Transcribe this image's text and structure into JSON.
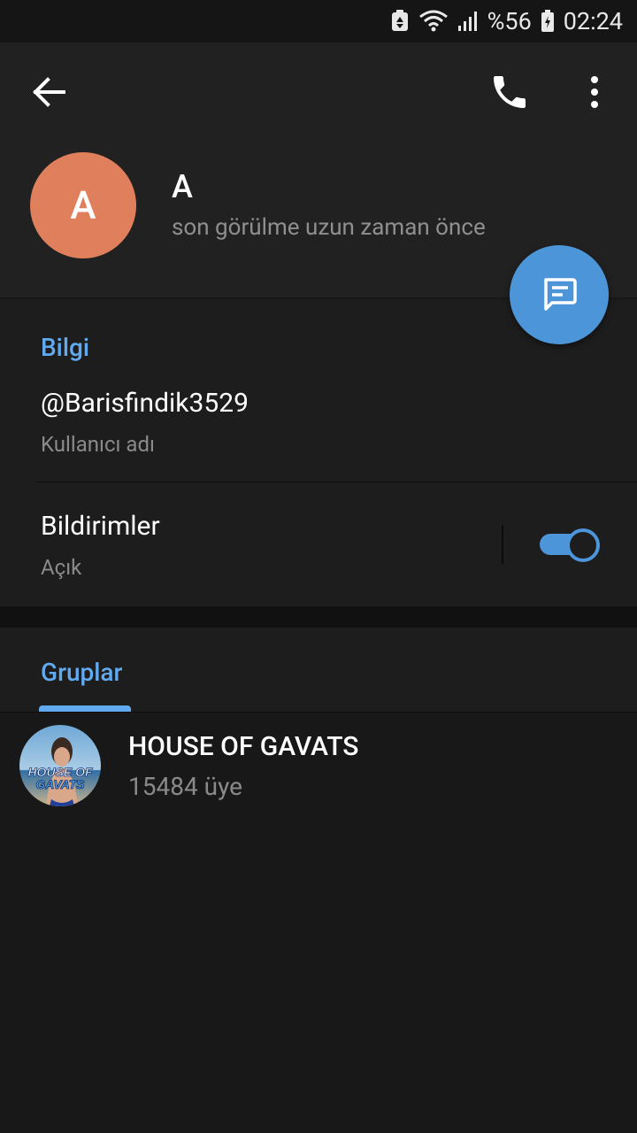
{
  "status_bar": {
    "battery_percent": "%56",
    "time": "02:24"
  },
  "header": {
    "avatar_letter": "A",
    "name": "A",
    "last_seen": "son görülme uzun zaman önce"
  },
  "info": {
    "section_title": "Bilgi",
    "username": "@Barisfindik3529",
    "username_label": "Kullanıcı adı",
    "notifications_title": "Bildirimler",
    "notifications_status": "Açık",
    "notifications_enabled": true
  },
  "groups": {
    "tab_label": "Gruplar",
    "items": [
      {
        "name": "HOUSE OF GAVATS",
        "members": "15484 üye",
        "avatar_text_line1": "HOUSE OF",
        "avatar_text_line2": "GAVATS"
      }
    ]
  },
  "colors": {
    "accent": "#4d95d9",
    "section_title": "#62aaf0",
    "avatar_bg": "#e07f5c",
    "header_bg": "#212121",
    "section_bg": "#1d1d1d",
    "page_bg": "#181818"
  },
  "icons": [
    "recycle-icon",
    "wifi-icon",
    "signal-icon",
    "battery-icon",
    "back-arrow-icon",
    "phone-icon",
    "more-vert-icon",
    "message-icon"
  ]
}
